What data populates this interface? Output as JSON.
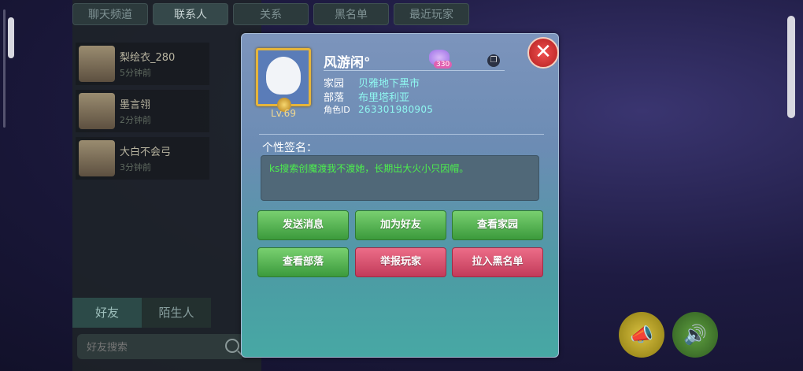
{
  "top_tabs": [
    "聊天频道",
    "联系人",
    "关系",
    "黑名单",
    "最近玩家"
  ],
  "contacts": [
    {
      "name": "梨绘衣_280",
      "status": "5分钟前"
    },
    {
      "name": "墨言翎",
      "status": "2分钟前"
    },
    {
      "name": "大白不会弓",
      "status": "3分钟前"
    }
  ],
  "bottom_tabs": [
    "好友",
    "陌生人"
  ],
  "search": {
    "placeholder": "好友搜索"
  },
  "profile": {
    "name": "风游闲°",
    "level": "Lv.69",
    "charm_value": "330",
    "home_label": "家园",
    "home_value": "贝雅地下黑市",
    "tribe_label": "部落",
    "tribe_value": "布里塔利亚",
    "role_id_label": "角色ID",
    "role_id_value": "263301980905",
    "signature_label": "个性签名：",
    "signature": "ks搜索创魔渡我不渡她，长期出大火小只因帽。"
  },
  "actions": {
    "send_message": "发送消息",
    "add_friend": "加为好友",
    "view_home": "查看家园",
    "view_tribe": "查看部落",
    "report_player": "举报玩家",
    "blacklist": "拉入黑名单"
  },
  "icons": {
    "close": "close-icon",
    "copy": "copy-icon",
    "charm": "heart-charm-icon",
    "search": "search-icon",
    "megaphone": "megaphone-icon",
    "voice": "voice-icon"
  },
  "colors": {
    "accent_cyan": "#8ff7f0",
    "signature_green": "#4cf04c",
    "button_green": "#3b9a3c",
    "button_red": "#c23b5a",
    "close_red": "#d93232"
  }
}
